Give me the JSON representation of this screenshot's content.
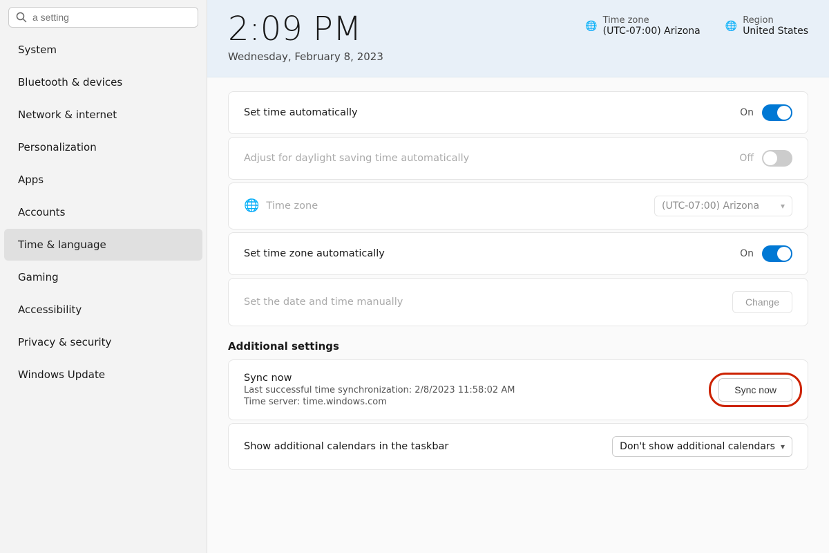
{
  "sidebar": {
    "search_placeholder": "a setting",
    "items": [
      {
        "id": "system",
        "label": "System",
        "active": false
      },
      {
        "id": "bluetooth",
        "label": "Bluetooth & devices",
        "active": false
      },
      {
        "id": "network",
        "label": "Network & internet",
        "active": false
      },
      {
        "id": "personalization",
        "label": "Personalization",
        "active": false
      },
      {
        "id": "apps",
        "label": "Apps",
        "active": false
      },
      {
        "id": "accounts",
        "label": "Accounts",
        "active": false
      },
      {
        "id": "time",
        "label": "Time & language",
        "active": true
      },
      {
        "id": "gaming",
        "label": "Gaming",
        "active": false
      },
      {
        "id": "accessibility",
        "label": "Accessibility",
        "active": false
      },
      {
        "id": "privacy",
        "label": "Privacy & security",
        "active": false
      },
      {
        "id": "windows-update",
        "label": "Windows Update",
        "active": false
      }
    ]
  },
  "header": {
    "time": "2:09 PM",
    "date": "Wednesday, February 8, 2023",
    "timezone_label": "Time zone",
    "timezone_value": "(UTC-07:00) Arizona",
    "region_label": "Region",
    "region_value": "United States"
  },
  "settings": {
    "set_time_auto_label": "Set time automatically",
    "set_time_auto_status": "On",
    "set_time_auto_state": "on",
    "daylight_label": "Adjust for daylight saving time automatically",
    "daylight_status": "Off",
    "daylight_state": "off",
    "timezone_label": "Time zone",
    "timezone_value": "(UTC-07:00) Arizona",
    "set_timezone_auto_label": "Set time zone automatically",
    "set_timezone_auto_status": "On",
    "set_timezone_auto_state": "on",
    "set_date_manual_label": "Set the date and time manually",
    "change_btn": "Change",
    "additional_settings_heading": "Additional settings",
    "sync_title": "Sync now",
    "sync_detail1": "Last successful time synchronization: 2/8/2023 11:58:02 AM",
    "sync_detail2": "Time server: time.windows.com",
    "sync_btn_label": "Sync now",
    "calendar_label": "Show additional calendars in the taskbar",
    "calendar_value": "Don't show additional calendars"
  }
}
